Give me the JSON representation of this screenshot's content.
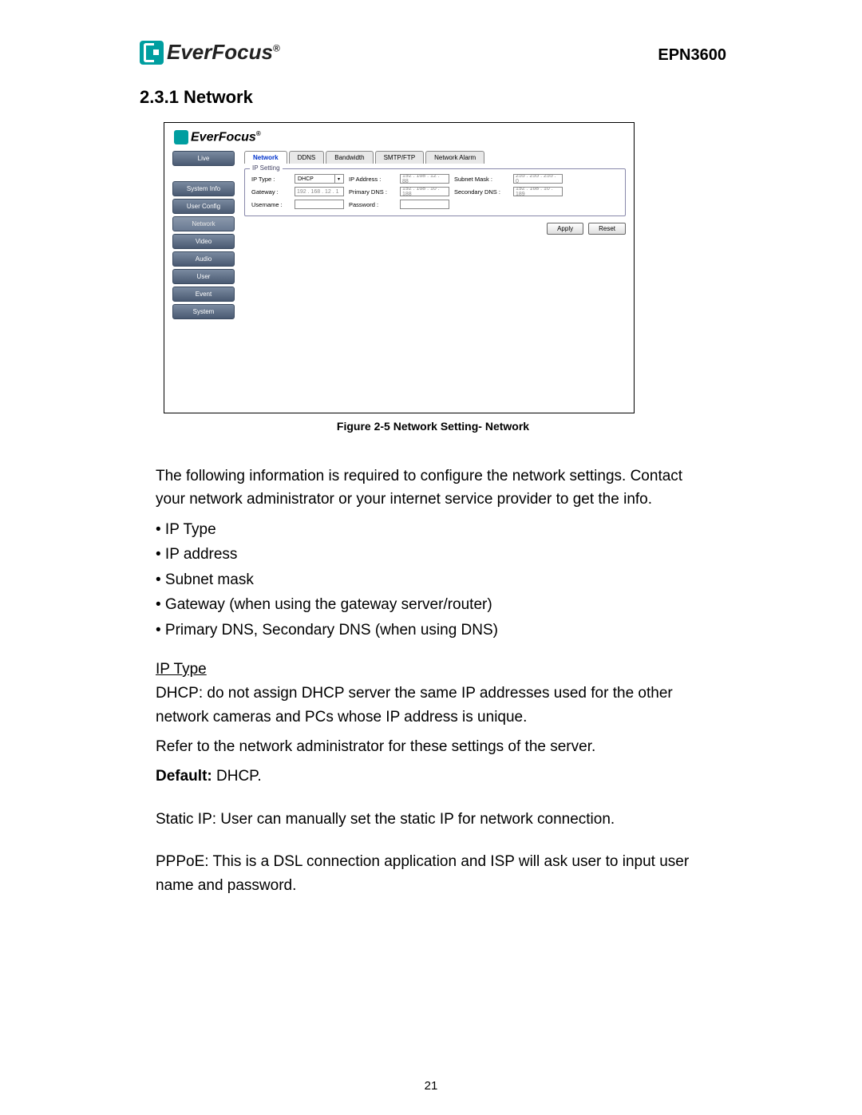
{
  "header": {
    "brand": "EverFocus",
    "model": "EPN3600"
  },
  "section": {
    "number_title": "2.3.1 Network"
  },
  "figure": {
    "brand": "EverFocus",
    "sidebar": [
      "Live",
      "System Info",
      "User Config",
      "Network",
      "Video",
      "Audio",
      "User",
      "Event",
      "System"
    ],
    "tabs": [
      "Network",
      "DDNS",
      "Bandwidth",
      "SMTP/FTP",
      "Network Alarm"
    ],
    "fieldset_legend": "IP Setting",
    "fields": {
      "ip_type_label": "IP Type :",
      "ip_type_value": "DHCP",
      "ip_address_label": "IP Address :",
      "ip_address_value": "192 . 168 . 12 . 88",
      "subnet_label": "Subnet Mask :",
      "subnet_value": "255 . 255 . 255 . 0",
      "gateway_label": "Gateway :",
      "gateway_value": "192 . 168 . 12 . 1",
      "primary_dns_label": "Primary DNS :",
      "primary_dns_value": "192 . 168 . 10 . 188",
      "secondary_dns_label": "Secondary DNS :",
      "secondary_dns_value": "192 . 168 . 10 . 189",
      "username_label": "Username :",
      "username_value": "",
      "password_label": "Password :",
      "password_value": ""
    },
    "buttons": {
      "apply": "Apply",
      "reset": "Reset"
    },
    "caption": "Figure 2-5 Network Setting- Network"
  },
  "content": {
    "intro": "The following information is required to configure the network settings. Contact your network administrator or your internet service provider to get the info.",
    "bullets": [
      "• IP Type",
      "• IP address",
      "• Subnet mask",
      "• Gateway (when using the gateway server/router)",
      "• Primary DNS, Secondary DNS (when using DNS)"
    ],
    "ip_type_heading": "IP Type",
    "dhcp_p1": "DHCP: do not assign DHCP server the same IP addresses used for the other network cameras and PCs whose IP address is unique.",
    "dhcp_p2": "Refer to the network administrator for these settings of the server.",
    "default_label": "Default:",
    "default_value": " DHCP.",
    "static_p": "Static IP: User can manually set the static IP for network connection.",
    "pppoe_p": "PPPoE: This is a DSL connection application and ISP will ask user to input user name and password."
  },
  "page_number": "21"
}
